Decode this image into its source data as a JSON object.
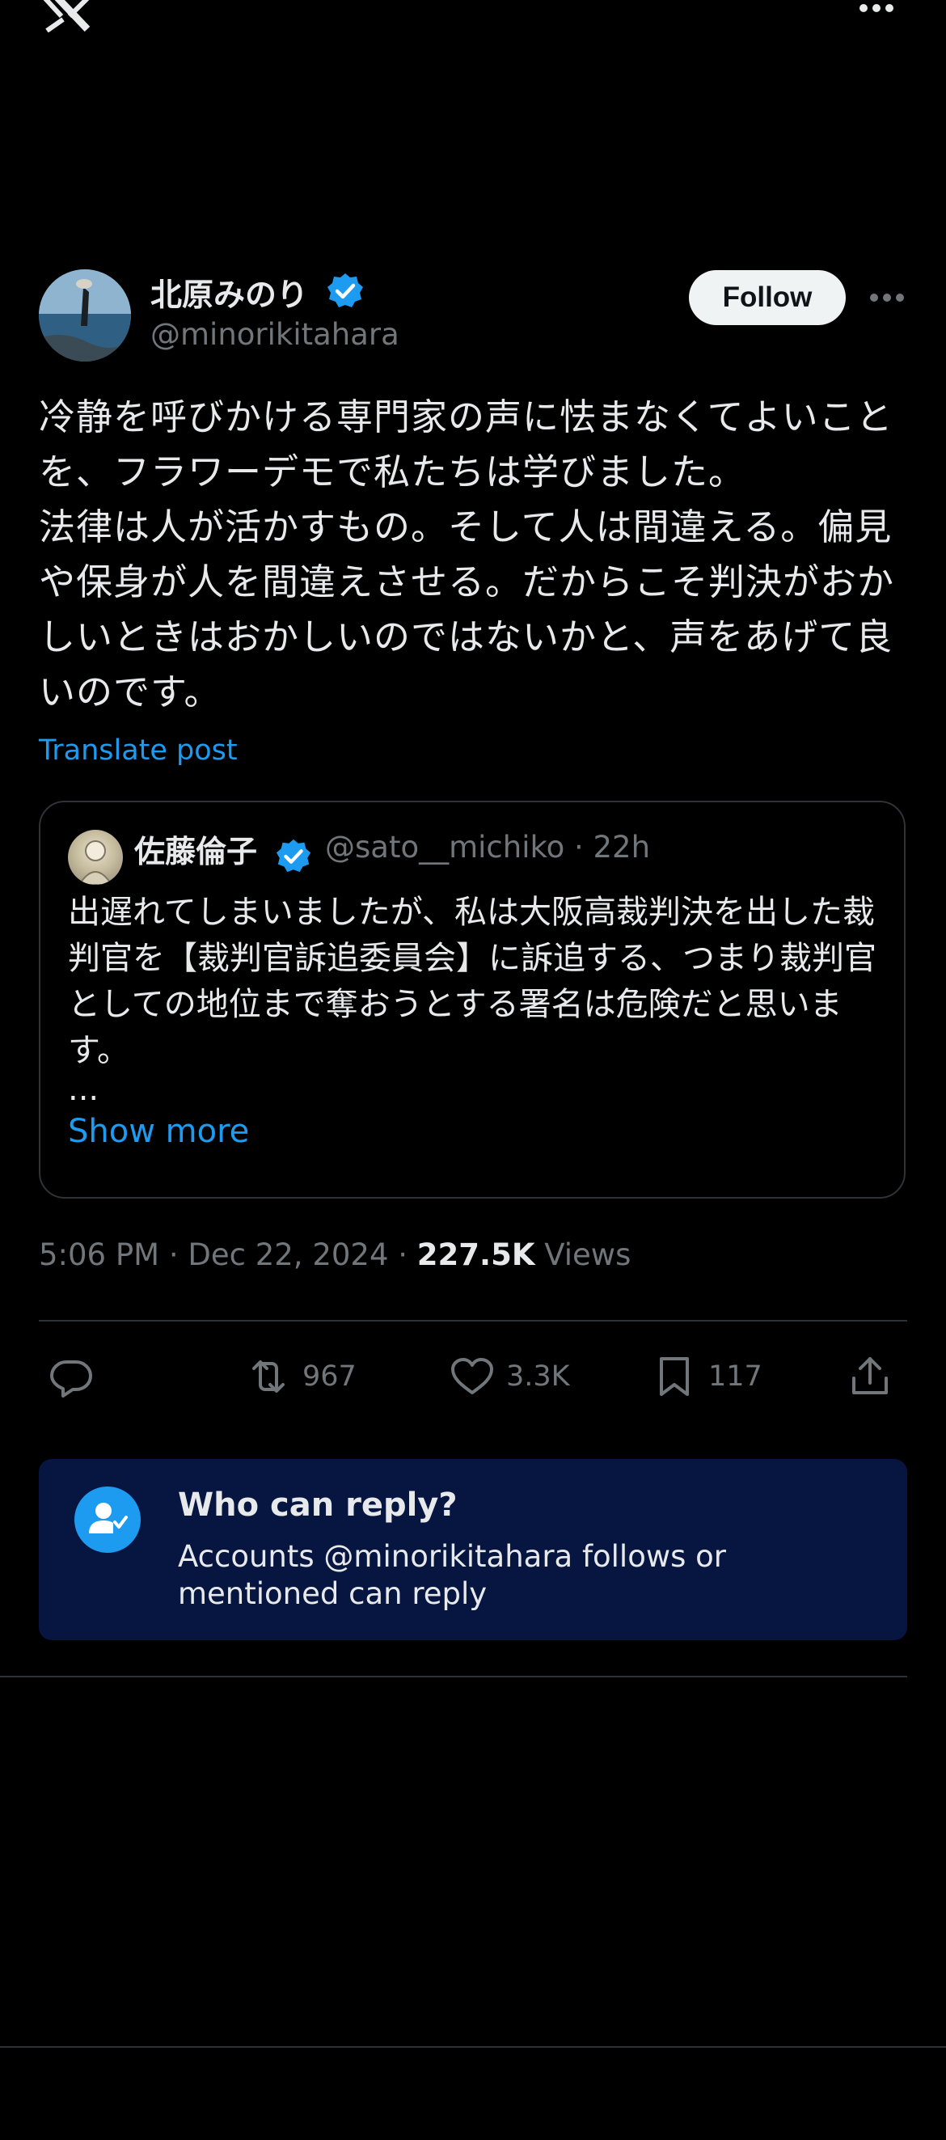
{
  "icons": {
    "app_logo": "x-logo-icon",
    "overflow": "more-horizontal-icon",
    "verified": "verified-badge-icon",
    "reply": "reply-icon",
    "repost": "repost-icon",
    "like": "heart-icon",
    "bookmark": "bookmark-icon",
    "share": "share-icon",
    "who_can_reply": "user-check-icon"
  },
  "colors": {
    "accent": "#1d9bf0",
    "muted": "#71767b",
    "who_bg": "#061641"
  },
  "post": {
    "author_name": "北原みのり",
    "author_handle": "@minorikitahara",
    "follow_label": "Follow",
    "text": "冷静を呼びかける専門家の声に怯まなくてよいことを、フラワーデモで私たちは学びました。\n法律は人が活かすもの。そして人は間違える。偏見や保身が人を間違えさせる。だからこそ判決がおかしいときはおかしいのではないかと、声をあげて良いのです。",
    "translate_label": "Translate post",
    "quote": {
      "author_name": "佐藤倫子",
      "author_handle": "@sato__michiko · 22h",
      "text": "出遅れてしまいましたが、私は大阪高裁判決を出した裁判官を【裁判官訴追委員会】に訴追する、つまり裁判官としての地位まで奪おうとする署名は危険だと思います。",
      "ellipsis": "...",
      "show_more": "Show more"
    },
    "timestamp": "5:06 PM · Dec 22, 2024 · ",
    "views_count": "227.5K",
    "views_label": " Views",
    "stats": {
      "reposts": "967",
      "likes": "3.3K",
      "bookmarks": "117"
    }
  },
  "who_can_reply": {
    "title": "Who can reply?",
    "description": "Accounts @minorikitahara follows or mentioned can reply"
  }
}
